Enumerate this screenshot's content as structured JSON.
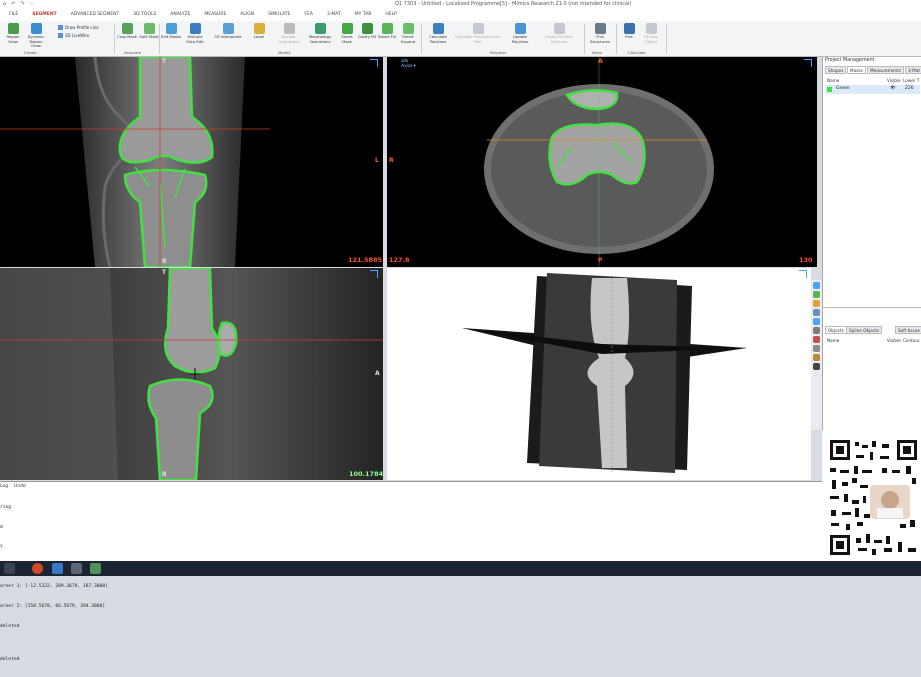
{
  "window": {
    "title": "Q1 7303 - Untitled - Localized Programme[5] - Mimics Research 21.0 (not intended for clinical)",
    "quick_access": [
      "⌂",
      "↶",
      "↷",
      "⋯"
    ]
  },
  "menu": {
    "tabs": [
      "FILE",
      "SEGMENT",
      "ADVANCED SEGMENT",
      "3D TOOLS",
      "ANALYZE",
      "MEASURE",
      "ALIGN",
      "SIMULATE",
      "FEA",
      "3-MAT",
      "MY TAB",
      "HELP"
    ],
    "active_index": 1
  },
  "ribbon": {
    "buttons": [
      {
        "label": "Region Grow",
        "enabled": true
      },
      {
        "label": "Dynamic Region Grow",
        "enabled": true
      },
      {
        "label": "Crop Mask",
        "enabled": true
      },
      {
        "label": "Split Mask",
        "enabled": true
      },
      {
        "label": "Edit Masks",
        "enabled": true
      },
      {
        "label": "Multiple Slice Edit",
        "enabled": true
      },
      {
        "label": "3D Interpolate",
        "enabled": true
      },
      {
        "label": "Label",
        "enabled": true
      },
      {
        "label": "Boolean Operations",
        "enabled": false
      },
      {
        "label": "Morphology Operations",
        "enabled": true
      },
      {
        "label": "Smart Mask",
        "enabled": true
      },
      {
        "label": "Cavity Fill",
        "enabled": true
      },
      {
        "label": "Smart Fill",
        "enabled": true
      },
      {
        "label": "Smart Expand",
        "enabled": true
      },
      {
        "label": "Calculate Polylines",
        "enabled": true
      },
      {
        "label": "Calculate Polylines from Part",
        "enabled": false
      },
      {
        "label": "Update Polylines",
        "enabled": true
      },
      {
        "label": "Cavity Fill from Polylines",
        "enabled": false
      },
      {
        "label": "Thin Structures",
        "enabled": true
      },
      {
        "label": "Part",
        "enabled": true
      },
      {
        "label": "Fit from Object",
        "enabled": false
      }
    ],
    "small_items": [
      "Draw Profile Line",
      "3D LiveWire"
    ],
    "groups": [
      "Create",
      "Separate",
      "Modify",
      "Polylines",
      "Wrap",
      "Calculate"
    ]
  },
  "viewports": {
    "coronal": {
      "top": "T",
      "bottom": "B",
      "right": "L",
      "value": "121.5885"
    },
    "axial": {
      "top": "A",
      "bottom": "P",
      "left": "R",
      "right": "L",
      "value_left": "127.8",
      "value_right": "130",
      "info": "a/b\nAxial ▾"
    },
    "sagittal": {
      "top": "T",
      "bottom": "B",
      "right": "A",
      "value": "100.1784"
    }
  },
  "colors": {
    "mask": "#43e043",
    "crosshair_red": "#d23a2d",
    "crosshair_orange": "#e08a1a",
    "value_red": "#ff4b2b",
    "value_green": "#8cff8c",
    "accent": "#4aa3ff"
  },
  "project_manager": {
    "title": "Project Management",
    "tabs": [
      "Shapes",
      "Masks",
      "Measurements",
      "3-Mat"
    ],
    "active_tab": 1,
    "columns": [
      "Name",
      "Visible",
      "Lower T"
    ],
    "masks": [
      {
        "name": "Green",
        "visible": "👁",
        "lower": "226"
      }
    ],
    "objects_tabs": [
      "Objects",
      "Spline Objects",
      "Soft tissue"
    ],
    "objects_columns": [
      "Name",
      "Visible",
      "Contour"
    ]
  },
  "log": {
    "tabs": [
      "Log",
      "Undo"
    ],
    "lines": [
      "ring",
      "d",
      "Y",
      "orr",
      "orner 1: [-12.5322, 289.3679, 187.3000]",
      "orner 2: [150.5678, 66.5679, 394.3000]",
      "deleted",
      "",
      "deleted"
    ]
  },
  "taskbar": {
    "icons": [
      "start-icon",
      "search-icon",
      "browser-icon",
      "folder-icon",
      "settings-icon",
      "mimics-icon"
    ]
  }
}
